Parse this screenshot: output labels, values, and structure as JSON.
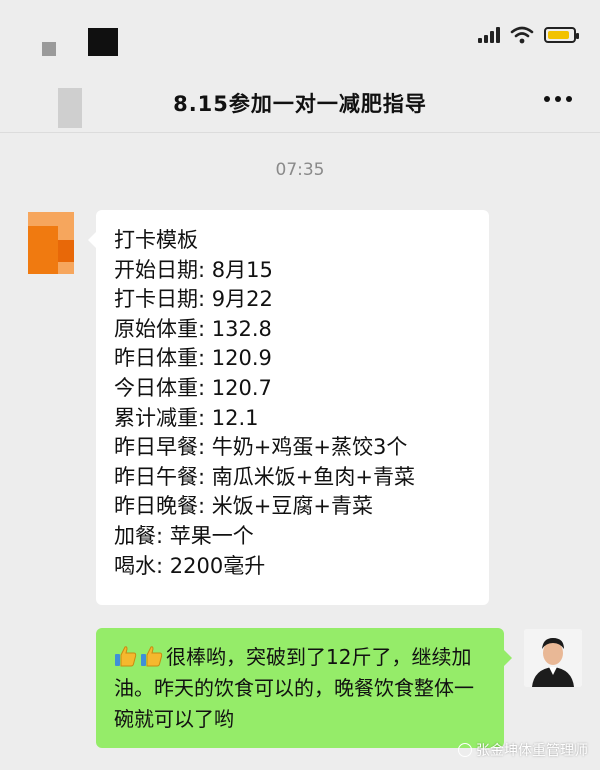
{
  "chat": {
    "title": "8.15参加一对一减肥指导",
    "time": "07:35"
  },
  "status_bar": {
    "battery_level": 0.8,
    "battery_color": "#f2c200"
  },
  "icons": {
    "menu": "more-dots-icon",
    "signal": "signal-icon",
    "wifi": "wifi-icon",
    "battery": "battery-icon",
    "emoji": "thumbs-up-icon"
  },
  "checkin": {
    "title": "打卡模板",
    "rows": [
      {
        "label": "开始日期:",
        "value": "8月15"
      },
      {
        "label": "打卡日期:",
        "value": "9月22"
      },
      {
        "label": "原始体重:",
        "value": "132.8"
      },
      {
        "label": "昨日体重:",
        "value": "120.9"
      },
      {
        "label": "今日体重:",
        "value": "120.7"
      },
      {
        "label": "累计减重:",
        "value": "12.1"
      },
      {
        "label": "昨日早餐:",
        "value": "牛奶+鸡蛋+蒸饺3个"
      },
      {
        "label": "昨日午餐:",
        "value": "南瓜米饭+鱼肉+青菜"
      },
      {
        "label": "昨日晚餐:",
        "value": "米饭+豆腐+青菜"
      },
      {
        "label": "加餐:",
        "value": "苹果一个"
      },
      {
        "label": "喝水:",
        "value": "2200毫升"
      }
    ]
  },
  "reply": {
    "text": "很棒哟，突破到了12斤了，继续加油。昨天的饮食可以的，晚餐饮食整体一碗就可以了哟"
  },
  "watermark": {
    "text": "张金坤体重管理师"
  },
  "colors": {
    "background": "#ededed",
    "bubble_left": "#ffffff",
    "bubble_right": "#95ec69",
    "time_text": "#8a8a8a"
  }
}
